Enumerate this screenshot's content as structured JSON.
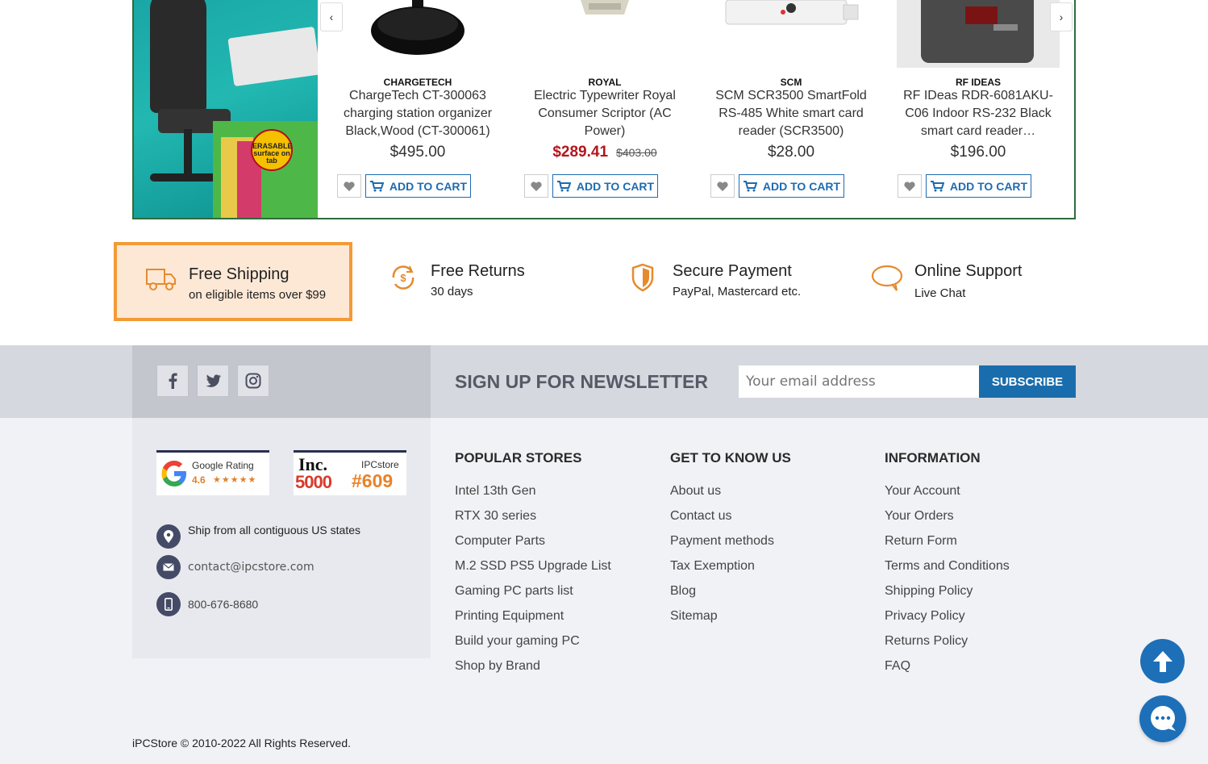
{
  "products": [
    {
      "brand": "CHARGETECH",
      "title": "ChargeTech CT-300063 charging station organizer Black,Wood (CT-300061)",
      "price": "$495.00",
      "old_price": "",
      "add_to_cart": "ADD TO CART"
    },
    {
      "brand": "ROYAL",
      "title": "Electric Typewriter Royal Consumer Scriptor (AC Power)",
      "price": "$289.41",
      "old_price": "$403.00",
      "add_to_cart": "ADD TO CART"
    },
    {
      "brand": "SCM",
      "title": "SCM SCR3500 SmartFold RS-485 White smart card reader (SCR3500)",
      "price": "$28.00",
      "old_price": "",
      "add_to_cart": "ADD TO CART"
    },
    {
      "brand": "RF IDEAS",
      "title": "RF IDeas RDR-6081AKU-C06 Indoor RS-232 Black smart card reader…",
      "price": "$196.00",
      "old_price": "",
      "add_to_cart": "ADD TO CART"
    }
  ],
  "banner": {
    "badge": "ERASABLE surface on tab"
  },
  "carousel": {
    "prev": "‹",
    "next": "›"
  },
  "features": [
    {
      "title": "Free Shipping",
      "subtitle": "on eligible items over $99"
    },
    {
      "title": "Free Returns",
      "subtitle": "30 days"
    },
    {
      "title": "Secure Payment",
      "subtitle": "PayPal, Mastercard etc."
    },
    {
      "title": "Online Support",
      "subtitle": "Live Chat"
    }
  ],
  "newsletter": {
    "title": "SIGN UP FOR NEWSLETTER",
    "placeholder": "Your email address",
    "button": "SUBSCRIBE"
  },
  "ratings": {
    "google": {
      "label": "Google Rating",
      "score": "4.6",
      "stars": "★★★★★"
    },
    "inc": {
      "logo": "Inc.",
      "number": "5000",
      "label": "IPCstore",
      "rank": "#609"
    }
  },
  "contact": {
    "ship": "Ship from all contiguous US states",
    "email": "contact@ipcstore.com",
    "phone": "800-676-8680"
  },
  "columns": [
    {
      "heading": "POPULAR STORES",
      "items": [
        "Intel 13th Gen",
        "RTX 30 series",
        "Computer Parts",
        "M.2 SSD PS5 Upgrade List",
        "Gaming PC parts list",
        "Printing Equipment",
        "Build your gaming PC",
        "Shop by Brand"
      ]
    },
    {
      "heading": "GET TO KNOW US",
      "items": [
        "About us",
        "Contact us",
        "Payment methods",
        "Tax Exemption",
        "Blog",
        "Sitemap"
      ]
    },
    {
      "heading": "INFORMATION",
      "items": [
        "Your Account",
        "Your Orders",
        "Return Form",
        "Terms and Conditions",
        "Shipping Policy",
        "Privacy Policy",
        "Returns Policy",
        "FAQ"
      ]
    }
  ],
  "copyright": "iPCStore © 2010-2022 All Rights Reserved.",
  "colors": {
    "accent": "#1d6bb0",
    "sale": "#b3161c",
    "feature_border": "#f39a36",
    "carousel_border": "#2f6b3c"
  },
  "icons": [
    "chevron-left-icon",
    "chevron-right-icon",
    "heart-icon",
    "cart-icon",
    "truck-icon",
    "returns-icon",
    "shield-icon",
    "chat-bubble-icon",
    "facebook-icon",
    "twitter-icon",
    "instagram-icon",
    "location-icon",
    "mail-icon",
    "phone-icon",
    "arrow-up-icon",
    "chat-icon"
  ]
}
